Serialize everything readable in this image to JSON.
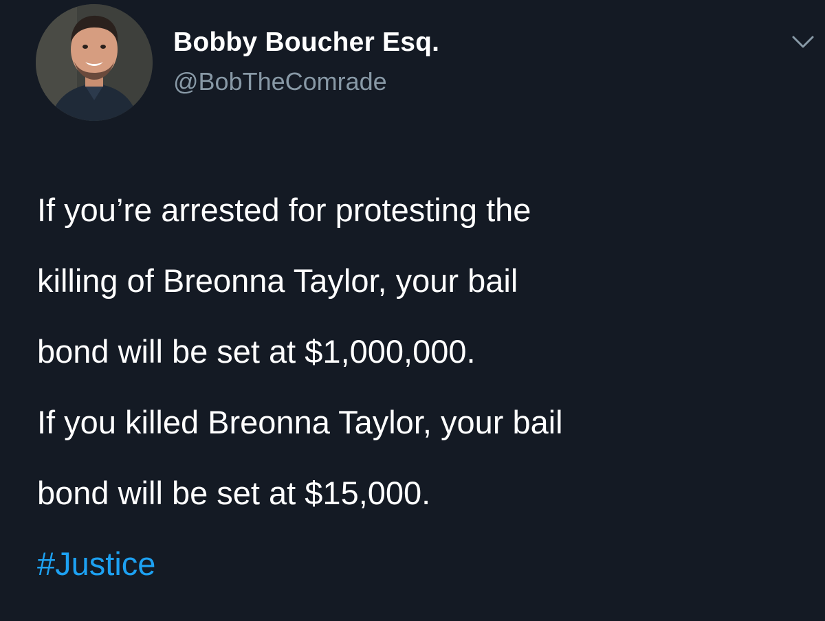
{
  "tweet": {
    "author": {
      "display_name": "Bobby Boucher Esq.",
      "handle": "@BobTheComrade"
    },
    "lines": [
      "If you’re arrested for protesting the",
      "killing of Breonna Taylor, your bail",
      "bond will be set at $1,000,000.",
      "If you killed Breonna Taylor, your bail",
      "bond will be set at $15,000."
    ],
    "hashtag": "#Justice",
    "menu_icon": "chevron-down-icon"
  },
  "colors": {
    "background": "#141a24",
    "text": "#ffffff",
    "secondary_text": "#8899a6",
    "link": "#1da1f2"
  }
}
